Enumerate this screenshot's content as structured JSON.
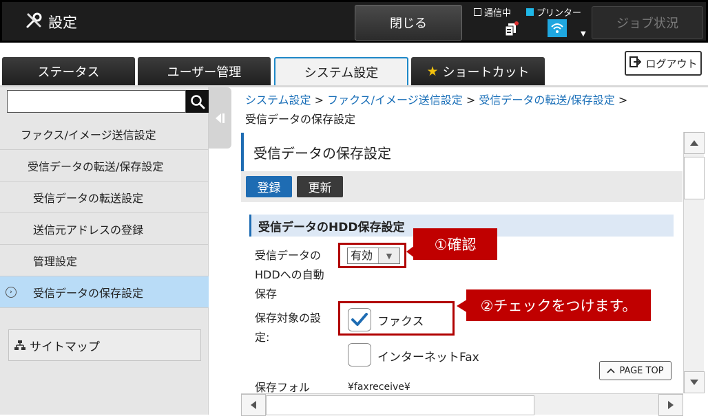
{
  "header": {
    "title": "設定",
    "close_label": "閉じる",
    "comm_label": "通信中",
    "printer_label": "プリンター",
    "job_status_label": "ジョブ状況",
    "colors": {
      "topbar": "#1d1d1d",
      "printer_indicator": "#1fb8e8"
    }
  },
  "tabs": [
    {
      "label": "ステータス"
    },
    {
      "label": "ユーザー管理"
    },
    {
      "label": "システム設定"
    },
    {
      "label": "ショートカット"
    }
  ],
  "logout_label": "ログアウト",
  "sidebar": {
    "search_placeholder": "",
    "items": [
      {
        "label": "ファクス/イメージ送信設定"
      },
      {
        "label": "受信データの転送/保存設定"
      },
      {
        "label": "受信データの転送設定"
      },
      {
        "label": "送信元アドレスの登録"
      },
      {
        "label": "管理設定"
      },
      {
        "label": "受信データの保存設定"
      }
    ],
    "sitemap_label": "サイトマップ"
  },
  "breadcrumb": {
    "links": [
      "システム設定",
      "ファクス/イメージ送信設定",
      "受信データの転送/保存設定"
    ],
    "separator": ">",
    "current": "受信データの保存設定"
  },
  "page": {
    "title": "受信データの保存設定",
    "register_label": "登録",
    "update_label": "更新",
    "section_title": "受信データのHDD保存設定",
    "auto_save_label_lines": [
      "受信データの",
      "HDDへの自動",
      "保存"
    ],
    "auto_save_value": "有効",
    "target_label_lines": [
      "保存対象の設",
      "定:"
    ],
    "fax_label": "ファクス",
    "fax_checked": true,
    "internet_fax_label": "インターネットFax",
    "internet_fax_checked": false,
    "folder_label": "保存フォル",
    "folder_value": "¥faxreceive¥",
    "page_top_label": "PAGE TOP"
  },
  "annotations": {
    "callout1": "①確認",
    "callout2": "②チェックをつけます。",
    "color": "#c00000"
  },
  "colors": {
    "accent": "#1e6cb3",
    "selected_nav": "#b9dcf7",
    "link": "#1a6fb8"
  }
}
